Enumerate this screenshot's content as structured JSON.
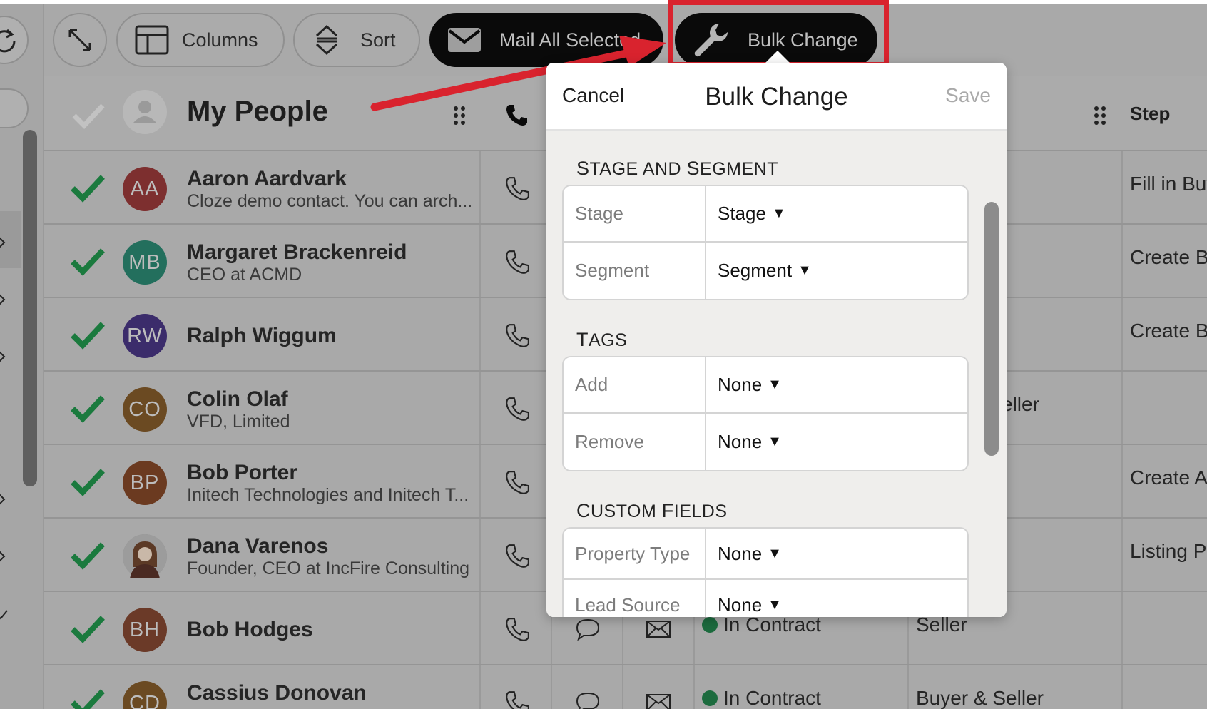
{
  "toolbar": {
    "columns_label": "Columns",
    "sort_label": "Sort",
    "mail_label": "Mail All Selected",
    "bulk_label": "Bulk Change"
  },
  "list": {
    "title": "My People",
    "step_header": "Step",
    "rows": [
      {
        "initials": "AA",
        "avatar_color": "#7d2f2f",
        "name": "Aaron Aardvark",
        "sub": "Cloze demo contact. You can arch...",
        "stage": "",
        "segment": "",
        "step": "Fill in Buy"
      },
      {
        "initials": "MB",
        "avatar_color": "#236f5d",
        "name": "Margaret Brackenreid",
        "sub": "CEO at ACMD",
        "stage": "",
        "segment": "",
        "step": "Create B"
      },
      {
        "initials": "RW",
        "avatar_color": "#3b2c6b",
        "name": "Ralph Wiggum",
        "sub": "",
        "stage": "",
        "segment": "",
        "step": "Create B"
      },
      {
        "initials": "CO",
        "avatar_color": "#6b4a22",
        "name": "Colin Olaf",
        "sub": "VFD, Limited",
        "stage": "",
        "segment": "eller",
        "step": ""
      },
      {
        "initials": "BP",
        "avatar_color": "#6b3a20",
        "name": "Bob Porter",
        "sub": "Initech Technologies and Initech T...",
        "stage": "",
        "segment": "",
        "step": "Create A"
      },
      {
        "initials": "",
        "avatar_color": "#6b5a4a",
        "name": "Dana Varenos",
        "sub": "Founder, CEO at IncFire Consulting",
        "stage": "",
        "segment": "",
        "step": "Listing Pr"
      },
      {
        "initials": "BH",
        "avatar_color": "#6b3a28",
        "name": "Bob Hodges",
        "sub": "",
        "stage": "In Contract",
        "segment": "Seller",
        "step": ""
      },
      {
        "initials": "CD",
        "avatar_color": "#6b4a22",
        "name": "Cassius Donovan",
        "sub": "",
        "stage": "In Contract",
        "segment": "Buyer & Seller",
        "step": ""
      }
    ]
  },
  "modal": {
    "cancel_label": "Cancel",
    "title": "Bulk Change",
    "save_label": "Save",
    "sections": {
      "stage_segment": {
        "first": "S",
        "rest": "TAGE AND ",
        "first2": "S",
        "rest2": "EGMENT"
      },
      "tags": {
        "first": "T",
        "rest": "AGS"
      },
      "custom": {
        "first": "C",
        "rest": "USTOM ",
        "first2": "F",
        "rest2": "IELDS"
      }
    },
    "fields": {
      "stage": {
        "label": "Stage",
        "value": "Stage"
      },
      "segment": {
        "label": "Segment",
        "value": "Segment"
      },
      "add": {
        "label": "Add",
        "value": "None"
      },
      "remove": {
        "label": "Remove",
        "value": "None"
      },
      "property_type": {
        "label": "Property Type",
        "value": "None"
      },
      "lead_source": {
        "label": "Lead Source",
        "value": "None"
      }
    }
  },
  "colors": {
    "accent_red": "#d9232e",
    "check_green": "#1b7a3e",
    "overlay_gray": "#a9a9a9"
  }
}
